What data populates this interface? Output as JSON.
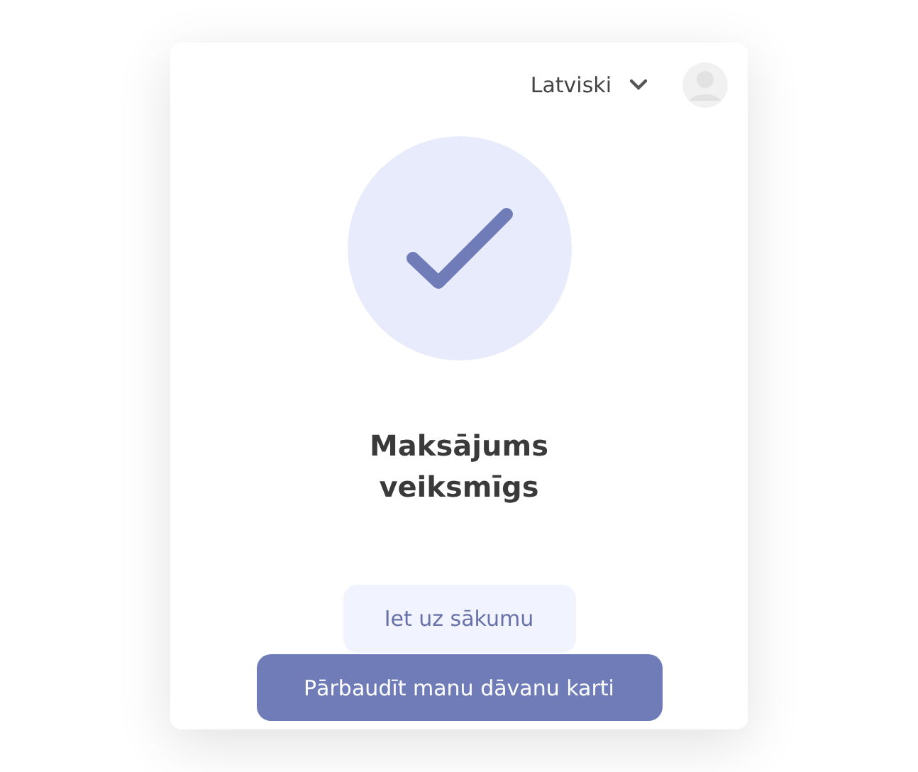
{
  "header": {
    "language": "Latviski"
  },
  "status": {
    "title": "Maksājums veiksmīgs"
  },
  "buttons": [
    {
      "label": "Iet uz sākumu",
      "kind": "secondary"
    },
    {
      "label": "Pārbaudīt manu dāvanu karti",
      "kind": "primary"
    }
  ]
}
